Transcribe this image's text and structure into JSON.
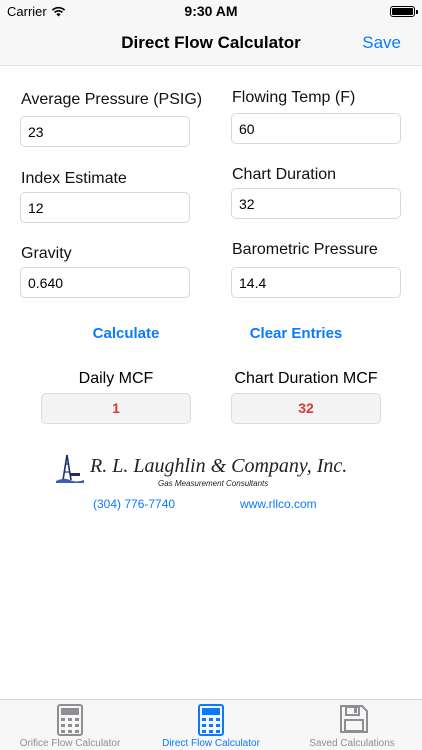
{
  "status_bar": {
    "carrier": "Carrier",
    "time": "9:30 AM"
  },
  "nav": {
    "title": "Direct Flow Calculator",
    "save_label": "Save"
  },
  "fields": {
    "average_pressure": {
      "label": "Average Pressure (PSIG)",
      "value": "23"
    },
    "flowing_temp": {
      "label": "Flowing Temp (F)",
      "value": "60"
    },
    "index_estimate": {
      "label": "Index Estimate",
      "value": "12"
    },
    "chart_duration": {
      "label": "Chart Duration",
      "value": "32"
    },
    "gravity": {
      "label": "Gravity",
      "value": "0.640"
    },
    "barometric_pressure": {
      "label": "Barometric Pressure",
      "value": "14.4"
    }
  },
  "actions": {
    "calculate_label": "Calculate",
    "clear_label": "Clear Entries"
  },
  "results": {
    "daily_mcf": {
      "label": "Daily MCF",
      "value": "1"
    },
    "chart_duration_mcf": {
      "label": "Chart Duration MCF",
      "value": "32"
    }
  },
  "company": {
    "name": "R. L. Laughlin & Company, Inc.",
    "subtitle": "Gas Measurement Consultants",
    "phone": "(304) 776-7740",
    "website": "www.rllco.com"
  },
  "tabs": [
    {
      "label": "Orifice Flow Calculator",
      "icon": "calculator-icon",
      "active": false
    },
    {
      "label": "Direct Flow Calculator",
      "icon": "calculator-icon",
      "active": true
    },
    {
      "label": "Saved Calculations",
      "icon": "floppy-disk-icon",
      "active": false
    }
  ],
  "colors": {
    "accent": "#0a7aff",
    "result_text": "#e0362b",
    "inactive_tab": "#8e8e93"
  }
}
